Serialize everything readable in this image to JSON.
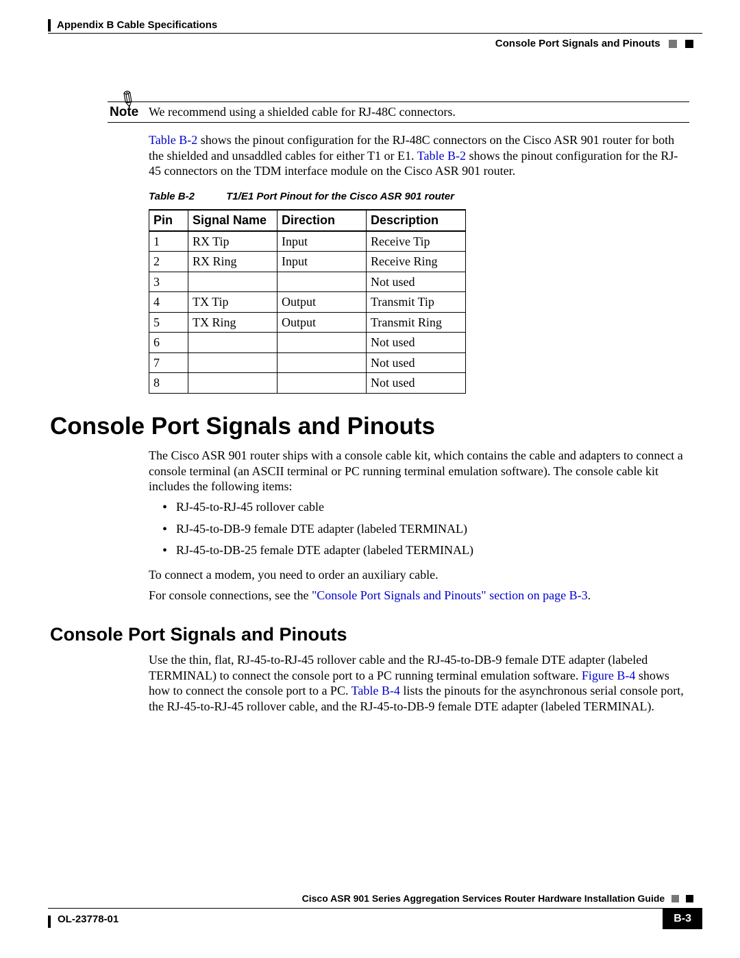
{
  "header": {
    "left": "Appendix B      Cable Specifications",
    "right": "Console Port Signals and Pinouts"
  },
  "note": {
    "label": "Note",
    "text": "We recommend using a shielded cable for RJ-48C connectors."
  },
  "para1": {
    "l1a": "Table B-2",
    "l1b": " shows the pinout configuration for the RJ-48C connectors on the Cisco ASR 901 router for both the shielded and unsaddled cables for either T1 or E1. ",
    "l1c": "Table B-2",
    "l1d": " shows the pinout configuration for the RJ-45 connectors on the TDM interface module on the Cisco ASR 901 router."
  },
  "table": {
    "caption_id": "Table B-2",
    "caption_title": "T1/E1 Port Pinout for the Cisco ASR 901 router",
    "headers": {
      "c1": "Pin",
      "c2": "Signal Name",
      "c3": "Direction",
      "c4": "Description"
    },
    "rows": [
      {
        "c1": "1",
        "c2": "RX Tip",
        "c3": "Input",
        "c4": "Receive Tip"
      },
      {
        "c1": "2",
        "c2": "RX Ring",
        "c3": "Input",
        "c4": "Receive Ring"
      },
      {
        "c1": "3",
        "c2": "",
        "c3": "",
        "c4": "Not used"
      },
      {
        "c1": "4",
        "c2": "TX Tip",
        "c3": "Output",
        "c4": "Transmit Tip"
      },
      {
        "c1": "5",
        "c2": "TX Ring",
        "c3": "Output",
        "c4": "Transmit Ring"
      },
      {
        "c1": "6",
        "c2": "",
        "c3": "",
        "c4": "Not used"
      },
      {
        "c1": "7",
        "c2": "",
        "c3": "",
        "c4": "Not used"
      },
      {
        "c1": "8",
        "c2": "",
        "c3": "",
        "c4": "Not used"
      }
    ]
  },
  "h1": "Console Port Signals and Pinouts",
  "para2": "The Cisco ASR 901 router ships with a console cable kit, which contains the cable and adapters to connect a console terminal (an ASCII terminal or PC running terminal emulation software). The console cable kit includes the following items:",
  "kit": [
    "RJ-45-to-RJ-45 rollover cable",
    "RJ-45-to-DB-9 female DTE adapter (labeled TERMINAL)",
    "RJ-45-to-DB-25 female DTE adapter (labeled TERMINAL)"
  ],
  "para3": "To connect a modem, you need to order an auxiliary cable.",
  "para4": {
    "a": "For console connections, see the ",
    "b": "\"Console Port Signals and Pinouts\" section on page B-3",
    "c": "."
  },
  "h2": "Console Port Signals and Pinouts",
  "para5": {
    "a": "Use the thin, flat, RJ-45-to-RJ-45 rollover cable and the RJ-45-to-DB-9 female DTE adapter (labeled TERMINAL) to connect the console port to a PC running terminal emulation software. ",
    "b": "Figure B-4",
    "c": " shows how to connect the console port to a PC. ",
    "d": "Table B-4",
    "e": " lists the pinouts for the asynchronous serial console port, the RJ-45-to-RJ-45 rollover cable, and the RJ-45-to-DB-9 female DTE adapter (labeled TERMINAL)."
  },
  "footer": {
    "title": "Cisco ASR 901 Series Aggregation Services Router Hardware Installation Guide",
    "left": "OL-23778-01",
    "page": "B-3"
  }
}
